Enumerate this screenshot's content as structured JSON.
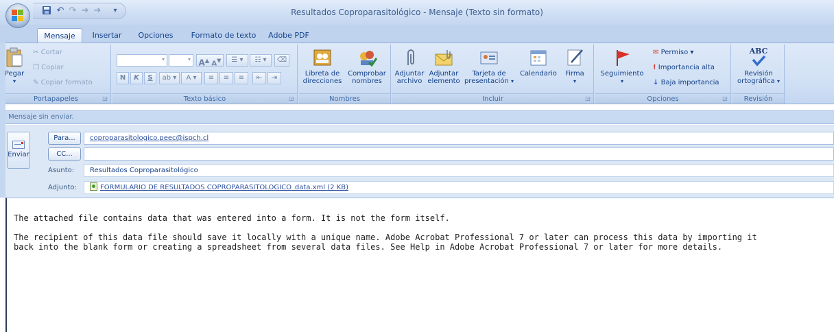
{
  "window": {
    "title": "Resultados Coproparasitológico - Mensaje (Texto sin formato)"
  },
  "quick_access": {
    "items": [
      "save-icon",
      "undo-icon",
      "redo-icon",
      "previous-icon",
      "next-icon",
      "customize-icon"
    ]
  },
  "tabs": [
    {
      "label": "Mensaje",
      "active": true
    },
    {
      "label": "Insertar",
      "active": false
    },
    {
      "label": "Opciones",
      "active": false
    },
    {
      "label": "Formato de texto",
      "active": false
    },
    {
      "label": "Adobe PDF",
      "active": false
    }
  ],
  "ribbon": {
    "clipboard": {
      "label": "Portapapeles",
      "paste": "Pegar",
      "cut": "Cortar",
      "copy": "Copiar",
      "format_painter": "Copiar formato"
    },
    "basic_text": {
      "label": "Texto básico",
      "bold": "N",
      "italic": "K",
      "underline": "S",
      "grow_font": "A",
      "shrink_font": "A"
    },
    "names": {
      "label": "Nombres",
      "address_book_line1": "Libreta de",
      "address_book_line2": "direcciones",
      "check_names_line1": "Comprobar",
      "check_names_line2": "nombres"
    },
    "include": {
      "label": "Incluir",
      "attach_file_line1": "Adjuntar",
      "attach_file_line2": "archivo",
      "attach_item_line1": "Adjuntar",
      "attach_item_line2": "elemento",
      "business_card_line1": "Tarjeta de",
      "business_card_line2": "presentación",
      "calendar": "Calendario",
      "signature": "Firma"
    },
    "options": {
      "label": "Opciones",
      "follow_up": "Seguimiento",
      "permission": "Permiso",
      "high_importance": "Importancia alta",
      "low_importance": "Baja importancia"
    },
    "review": {
      "label": "Revisión",
      "spelling_line1": "Revisión",
      "spelling_line2": "ortográfica",
      "abc": "ABC"
    }
  },
  "message": {
    "info": "Mensaje sin enviar.",
    "send": "Enviar",
    "to_button": "Para...",
    "to_value": "coproparasitologico.peec@ispch.cl",
    "cc_button": "CC...",
    "cc_value": "",
    "subject_label": "Asunto:",
    "subject_value": "Resultados Coproparasitológico",
    "attachment_label": "Adjunto:",
    "attachment_value": "FORMULARIO DE RESULTADOS COPROPARASITOLOGICO_data.xml (2 KB)"
  },
  "body": {
    "line1": "The attached file contains data that was entered into a form. It is not the form itself.",
    "line2": "The recipient of this data file should save it locally with a unique name. Adobe Acrobat Professional 7 or later can process this data by importing it",
    "line3": "back into the blank form or creating a spreadsheet from several data files. See Help in Adobe Acrobat Professional 7 or later for more details."
  }
}
